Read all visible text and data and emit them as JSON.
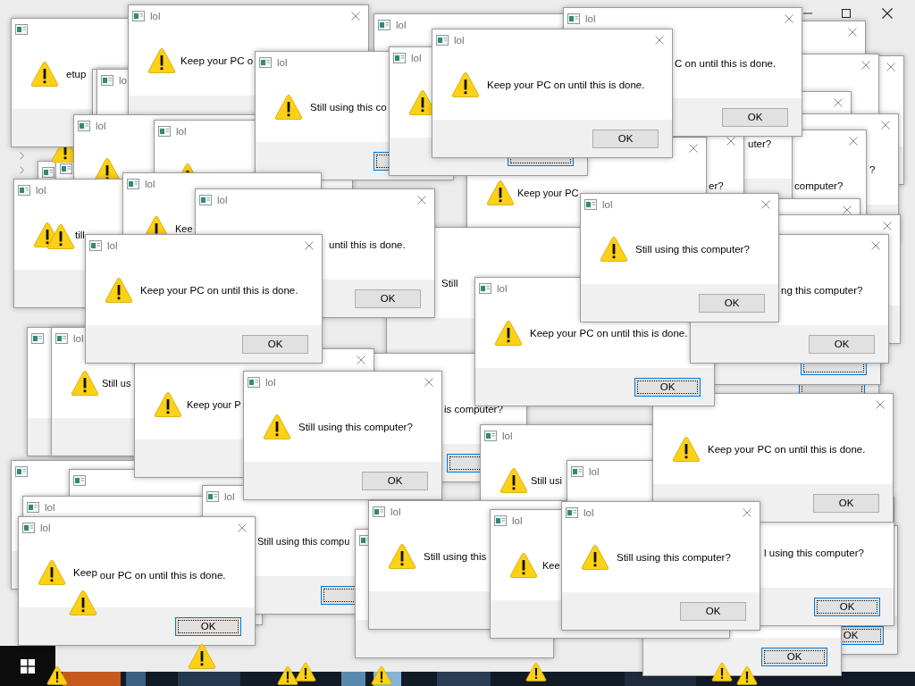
{
  "windows": [
    {
      "title": "lol",
      "message": "Keep your PC o"
    },
    {
      "title": "lol"
    },
    {
      "message": "etup"
    },
    {
      "title": "lo"
    },
    {
      "title": "lol"
    },
    {
      "title": "lol"
    },
    {
      "title": "lol",
      "message": "Still using this co",
      "button": {
        "focused": true
      }
    },
    {
      "title": "lol",
      "button": {
        "focused": true
      }
    },
    {
      "title": "lol",
      "message": "Keep your PC on until this is done.",
      "button": {
        "label": "OK",
        "focused": false
      }
    },
    {
      "title": "lol",
      "message": "C on until this is done.",
      "button": {
        "label": "OK",
        "focused": false
      }
    },
    {
      "message": "uter?"
    },
    {
      "message": "?"
    },
    {
      "title": "lol",
      "message": "till"
    },
    {
      "title": "lol",
      "message": "Kee"
    },
    {
      "title": "lol",
      "message": "Keep your PC on until this is done.",
      "button": {
        "label": "OK",
        "focused": false
      }
    },
    {
      "title": "lol",
      "message": "until this is done.",
      "button": {
        "label": "OK",
        "focused": false
      }
    },
    {
      "message": "Keep your PC"
    },
    {
      "message": "er?"
    },
    {
      "message": "computer?"
    },
    {
      "message": "Still"
    },
    {
      "title": "lol",
      "message": "Still using this computer?",
      "button": {
        "label": "OK",
        "focused": false
      }
    },
    {
      "title": "lol",
      "message": "Still us"
    },
    {
      "title": "lol",
      "message": "Keep your PC on until this is done.",
      "button": {
        "label": "OK",
        "focused": true
      }
    },
    {
      "message": "ng this computer?",
      "button": {
        "label": "OK",
        "focused": false
      }
    },
    {
      "button": {
        "focused": true
      }
    },
    {
      "button": {
        "focused": true
      }
    },
    {
      "message": "Keep your P"
    },
    {
      "title": "lol",
      "message": "Still using this computer?",
      "button": {
        "label": "OK",
        "focused": false
      }
    },
    {
      "message": "is computer?",
      "button": {
        "focused": true
      }
    },
    {
      "title": "lol",
      "message": "Still usi"
    },
    {
      "title": "lol"
    },
    {
      "title": "lol"
    },
    {
      "title": "lol",
      "message": "Still using this compu",
      "button": {
        "focused": true
      }
    },
    {
      "title": "lol",
      "message": "Still using this"
    },
    {
      "title": "lol",
      "message": "Kee"
    },
    {
      "title": "lol",
      "message": "Still using this computer?",
      "button": {
        "label": "OK",
        "focused": false
      }
    },
    {
      "message": "Keep your PC on until this is done.",
      "button": {
        "label": "OK",
        "focused": false
      }
    },
    {
      "title": "lol",
      "message": "Keep",
      "overlay_text": "our PC on until this is done.",
      "button": {
        "label": "OK",
        "focused": true
      }
    },
    {
      "message": "l using this computer?",
      "button": {
        "label": "OK",
        "focused": true
      }
    },
    {
      "button": {
        "label": "OK",
        "focused": true
      }
    },
    {
      "button": {
        "label": "OK",
        "focused": true
      }
    }
  ]
}
